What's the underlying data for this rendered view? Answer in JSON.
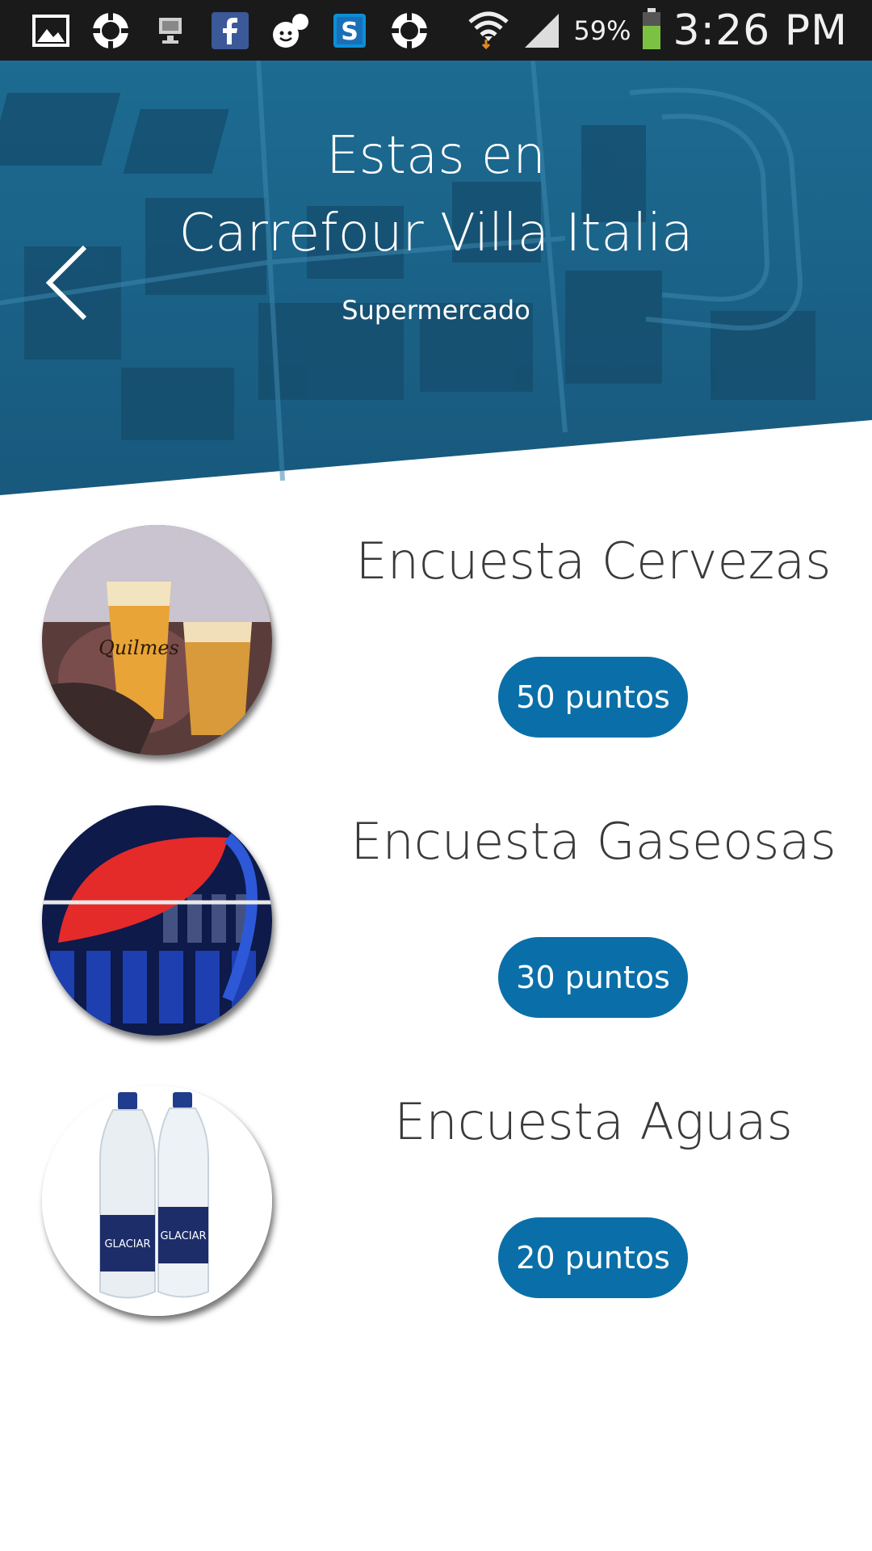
{
  "status_bar": {
    "icons": [
      "gallery-icon",
      "sync-icon",
      "monitor-icon",
      "facebook-icon",
      "messenger-icon",
      "skype-icon",
      "sync-icon",
      "wifi-icon",
      "signal-icon",
      "battery-icon"
    ],
    "battery_percent": "59%",
    "time": "3:26 PM"
  },
  "header": {
    "title_line1": "Estas en",
    "title_line2": "Carrefour Villa Italia",
    "subtitle": "Supermercado",
    "back_icon": "chevron-left-icon"
  },
  "surveys": [
    {
      "title": "Encuesta Cervezas",
      "points_label": "50 puntos"
    },
    {
      "title": "Encuesta Gaseosas",
      "points_label": "30 puntos"
    },
    {
      "title": "Encuesta Aguas",
      "points_label": "20 puntos"
    }
  ],
  "colors": {
    "status_bar_bg": "#1a1a1a",
    "header_bg": "#1f6a92",
    "accent": "#0a6fa8",
    "title_text": "#3a3a3a"
  }
}
